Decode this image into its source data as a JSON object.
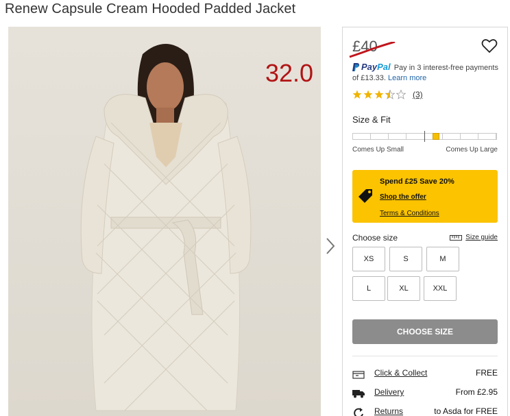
{
  "product": {
    "title": "Renew Capsule Cream Hooded Padded Jacket",
    "sale_price": "32.0",
    "old_price": "£40"
  },
  "paypal": {
    "logo_part1": "Pay",
    "logo_part2": "Pal",
    "text": "Pay in 3 interest-free payments of £13.33.",
    "learn_more": "Learn more"
  },
  "rating": {
    "stars": 3.5,
    "max": 5,
    "count": "(3)"
  },
  "size_fit": {
    "title": "Size & Fit",
    "low_label": "Comes Up Small",
    "high_label": "Comes Up Large",
    "position": 0.58
  },
  "offer": {
    "title": "Spend £25 Save 20%",
    "link": "Shop the offer",
    "terms": "Terms & Conditions"
  },
  "sizes": {
    "label": "Choose size",
    "guide": "Size guide",
    "options": [
      "XS",
      "S",
      "M",
      "L",
      "XL",
      "XXL"
    ]
  },
  "cta": {
    "label": "CHOOSE SIZE"
  },
  "delivery": [
    {
      "icon": "store-icon",
      "label": "Click & Collect",
      "value": "FREE"
    },
    {
      "icon": "truck-icon",
      "label": "Delivery",
      "value": "From £2.95"
    },
    {
      "icon": "returns-icon",
      "label": "Returns",
      "value": "to Asda for FREE"
    }
  ],
  "colors": {
    "sale_price": "#b11414",
    "offer_bg": "#fbc300",
    "cta_bg": "#8c8c8c",
    "paypal_dark": "#253b80",
    "paypal_light": "#179bd7"
  }
}
